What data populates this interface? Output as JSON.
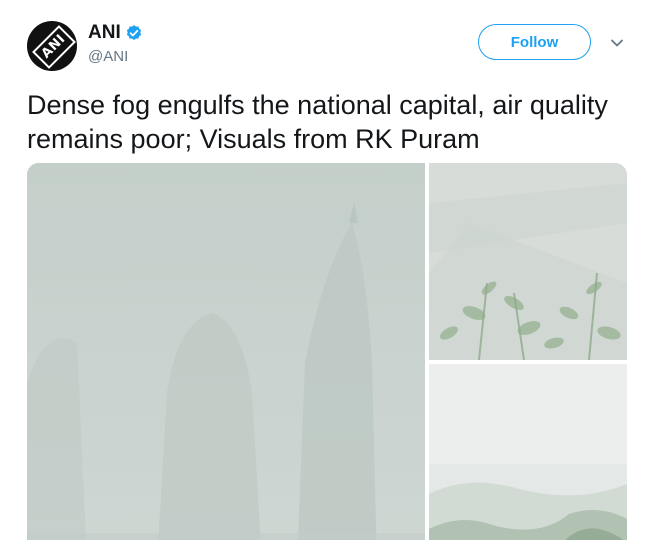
{
  "tweet": {
    "author": {
      "name": "ANI",
      "handle": "@ANI",
      "verified": true,
      "avatar_icon": "ani-logo-avatar",
      "avatar_text": "ANI"
    },
    "follow_label": "Follow",
    "menu_icon": "chevron-down-icon",
    "text": "Dense fog engulfs the national capital, air quality remains poor; Visuals from RK Puram",
    "media": [
      {
        "icon": "photo-fog-temple"
      },
      {
        "icon": "photo-fog-plants"
      },
      {
        "icon": "photo-fog-trees"
      }
    ],
    "colors": {
      "accent": "#1da1f2",
      "text": "#14171a",
      "secondary": "#657786"
    }
  }
}
